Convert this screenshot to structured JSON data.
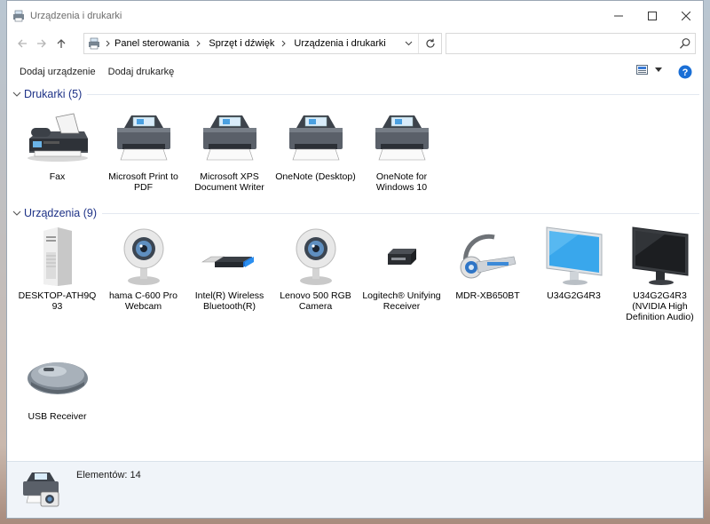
{
  "window": {
    "title": "Urządzenia i drukarki"
  },
  "address": {
    "crumbs": [
      "Panel sterowania",
      "Sprzęt i dźwięk",
      "Urządzenia i drukarki"
    ]
  },
  "search": {
    "placeholder": ""
  },
  "toolbar": {
    "add_device": "Dodaj urządzenie",
    "add_printer": "Dodaj drukarkę"
  },
  "groups": {
    "printers": {
      "title": "Drukarki (5)",
      "items": [
        {
          "label": "Fax",
          "icon": "fax-icon"
        },
        {
          "label": "Microsoft Print to PDF",
          "icon": "printer-icon"
        },
        {
          "label": "Microsoft XPS Document Writer",
          "icon": "printer-icon"
        },
        {
          "label": "OneNote (Desktop)",
          "icon": "printer-icon"
        },
        {
          "label": "OneNote for Windows 10",
          "icon": "printer-icon"
        }
      ]
    },
    "devices": {
      "title": "Urządzenia (9)",
      "items": [
        {
          "label": "DESKTOP-ATH9Q 93",
          "icon": "computer-tower-icon"
        },
        {
          "label": "hama C-600 Pro Webcam",
          "icon": "webcam-icon"
        },
        {
          "label": "Intel(R) Wireless Bluetooth(R)",
          "icon": "usb-dongle-icon"
        },
        {
          "label": "Lenovo 500 RGB Camera",
          "icon": "webcam-icon"
        },
        {
          "label": "Logitech® Unifying Receiver",
          "icon": "logitech-receiver-icon"
        },
        {
          "label": "MDR-XB650BT",
          "icon": "headset-icon"
        },
        {
          "label": "U34G2G4R3",
          "icon": "monitor-icon"
        },
        {
          "label": "U34G2G4R3 (NVIDIA High Definition Audio)",
          "icon": "monitor-dark-icon"
        },
        {
          "label": "USB Receiver",
          "icon": "mouse-icon"
        }
      ]
    }
  },
  "status": {
    "text": "Elementów: 14"
  },
  "colors": {
    "group_title": "#1e3287",
    "status_bg": "#f0f4f9",
    "help": "#1a6fd6"
  }
}
